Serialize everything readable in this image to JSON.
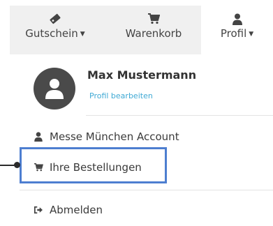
{
  "nav": {
    "gutschein": {
      "label": "Gutschein",
      "icon": "tag-icon",
      "has_dropdown": true
    },
    "warenkorb": {
      "label": "Warenkorb",
      "icon": "cart-icon"
    },
    "profil": {
      "label": "Profil",
      "icon": "user-icon",
      "has_dropdown": true,
      "active": true
    }
  },
  "profile": {
    "name": "Max Mustermann",
    "edit_label": "Profil bearbeiten",
    "avatar_icon": "user-avatar-icon"
  },
  "menu": [
    {
      "label": "Messe München Account",
      "icon": "user-icon"
    },
    {
      "label": "Ihre Bestellungen",
      "icon": "cart-icon",
      "highlighted": true
    },
    {
      "label": "Abmelden",
      "icon": "sign-out-icon"
    }
  ],
  "colors": {
    "link": "#3fa9d4",
    "highlight": "#4d7ed0",
    "nav_background": "#f0f0f0"
  }
}
